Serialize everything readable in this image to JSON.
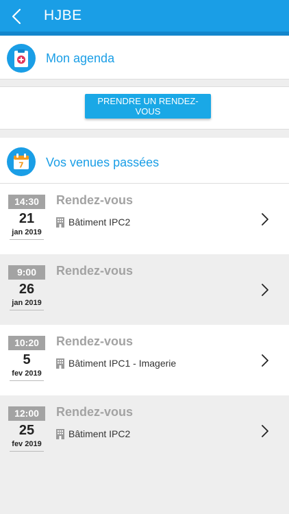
{
  "header": {
    "title": "HJBE",
    "back_icon": "chevron-left-icon"
  },
  "agenda": {
    "label": "Mon agenda",
    "icon": "clipboard-medical-icon"
  },
  "action": {
    "button_label": "PRENDRE UN RENDEZ-VOUS"
  },
  "past": {
    "label": "Vos venues passées",
    "icon": "calendar-icon",
    "icon_text": "7"
  },
  "appointments": [
    {
      "time": "14:30",
      "day": "21",
      "month": "jan 2019",
      "title": "Rendez-vous",
      "location": "Bâtiment IPC2"
    },
    {
      "time": "9:00",
      "day": "26",
      "month": "jan 2019",
      "title": "Rendez-vous",
      "location": ""
    },
    {
      "time": "10:20",
      "day": "5",
      "month": "fev 2019",
      "title": "Rendez-vous",
      "location": "Bâtiment IPC1 - Imagerie"
    },
    {
      "time": "12:00",
      "day": "25",
      "month": "fev 2019",
      "title": "Rendez-vous",
      "location": "Bâtiment IPC2"
    }
  ],
  "colors": {
    "primary": "#1a9ee6",
    "accent_red": "#e2345a",
    "calendar_orange": "#f39a1e",
    "muted_grey": "#a3a3a3"
  }
}
